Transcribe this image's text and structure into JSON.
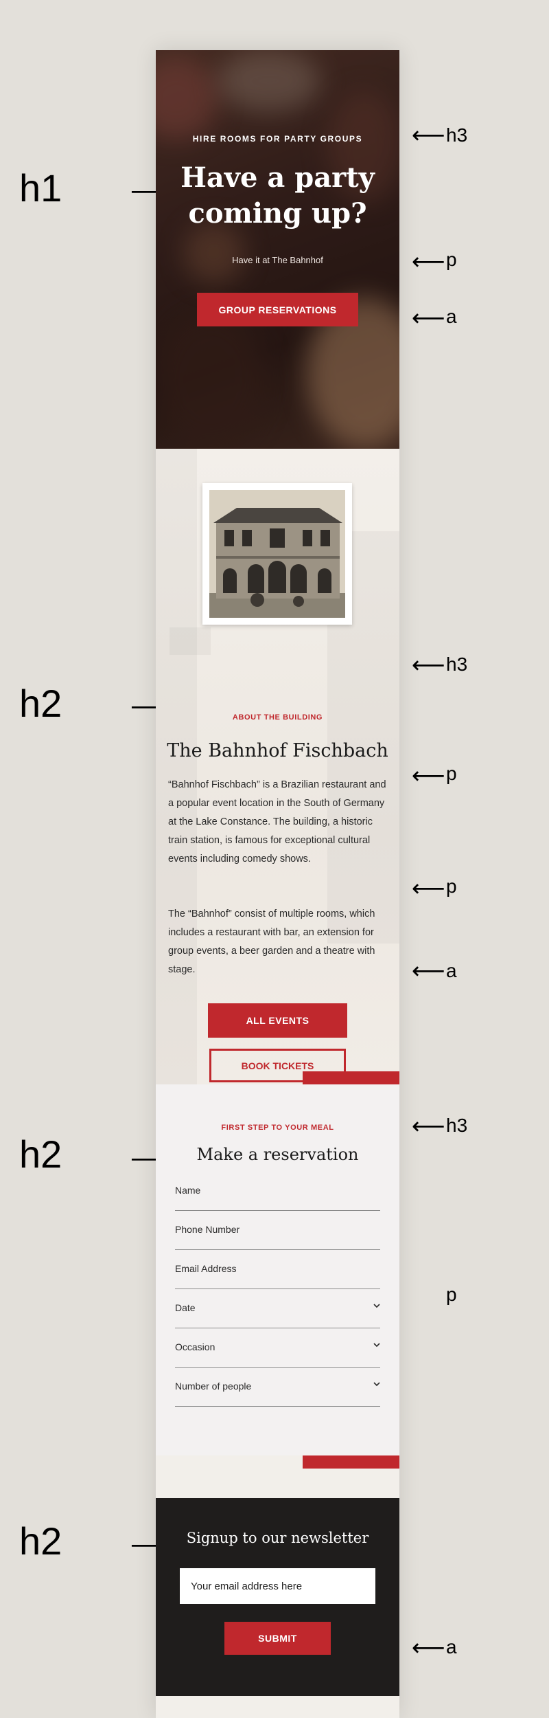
{
  "annotations": {
    "left": [
      {
        "tag": "h1"
      },
      {
        "tag": "h2"
      },
      {
        "tag": "h2"
      },
      {
        "tag": "h2"
      }
    ],
    "right": [
      {
        "tag": "h3"
      },
      {
        "tag": "p"
      },
      {
        "tag": "a"
      },
      {
        "tag": "h3"
      },
      {
        "tag": "p"
      },
      {
        "tag": "p"
      },
      {
        "tag": "a"
      },
      {
        "tag": "h3"
      },
      {
        "tag": "p"
      },
      {
        "tag": "a"
      }
    ],
    "arrow": "⟶",
    "arrow_left": "⟵"
  },
  "hero": {
    "eyebrow": "HIRE ROOMS FOR PARTY GROUPS",
    "title_line1": "Have a party",
    "title_line2": "coming up?",
    "subtitle": "Have it at The Bahnhof",
    "cta": "GROUP RESERVATIONS"
  },
  "about": {
    "eyebrow": "ABOUT THE BUILDING",
    "title": "The Bahnhof Fischbach",
    "paragraph1": "“Bahnhof Fischbach” is a Brazilian restaurant and a popular event location in the South of Germany at the Lake Constance. The building, a historic train station, is famous for exceptional cultural events including comedy shows.",
    "paragraph2": "The “Bahnhof” consist of multiple rooms, which includes a restaurant with bar, an extension for group events, a beer garden and a theatre with stage.",
    "primary_button": "ALL EVENTS",
    "secondary_button": "BOOK TICKETS"
  },
  "reservation": {
    "eyebrow": "FIRST STEP TO YOUR MEAL",
    "title": "Make a reservation",
    "fields": [
      {
        "label": "Name",
        "dropdown": false
      },
      {
        "label": "Phone Number",
        "dropdown": false
      },
      {
        "label": "Email Address",
        "dropdown": false
      },
      {
        "label": "Date",
        "dropdown": true
      },
      {
        "label": "Occasion",
        "dropdown": true
      },
      {
        "label": "Number of people",
        "dropdown": true
      }
    ]
  },
  "newsletter": {
    "title": "Signup to our newsletter",
    "placeholder": "Your email address here",
    "submit": "SUBMIT"
  },
  "colors": {
    "accent": "#c0282d",
    "page_background": "#e3e0da",
    "footer_dark": "#1f1d1c"
  },
  "icons": [
    "chevron-down-icon"
  ]
}
